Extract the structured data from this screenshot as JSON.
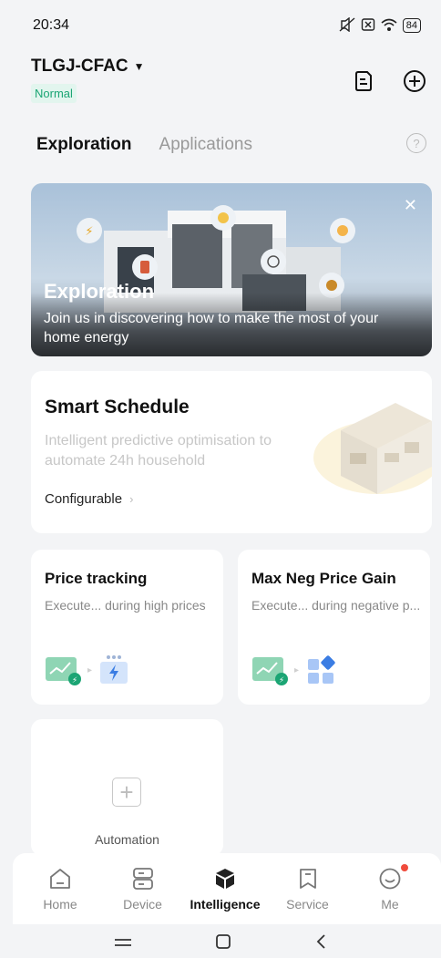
{
  "status_bar": {
    "time": "20:34",
    "battery": "84"
  },
  "header": {
    "device_name": "TLGJ-CFAC",
    "status": "Normal"
  },
  "tabs": [
    {
      "label": "Exploration",
      "active": true
    },
    {
      "label": "Applications",
      "active": false
    }
  ],
  "banner": {
    "title": "Exploration",
    "description": "Join us in discovering how to make the most of your home energy"
  },
  "smart_schedule": {
    "title": "Smart Schedule",
    "description": "Intelligent predictive optimisation to automate 24h household",
    "action": "Configurable"
  },
  "apps": [
    {
      "title": "Price tracking",
      "description": "Execute... during high prices"
    },
    {
      "title": "Max Neg Price Gain",
      "description": "Execute... during negative p..."
    }
  ],
  "automation": {
    "label": "Automation"
  },
  "bottom_nav": [
    {
      "label": "Home",
      "icon": "home-icon"
    },
    {
      "label": "Device",
      "icon": "device-icon"
    },
    {
      "label": "Intelligence",
      "icon": "intelligence-icon",
      "active": true
    },
    {
      "label": "Service",
      "icon": "service-icon"
    },
    {
      "label": "Me",
      "icon": "me-icon"
    }
  ],
  "colors": {
    "accent": "#1ba574",
    "badge_bg": "#e2f5ee",
    "notification": "#f04b3c"
  }
}
